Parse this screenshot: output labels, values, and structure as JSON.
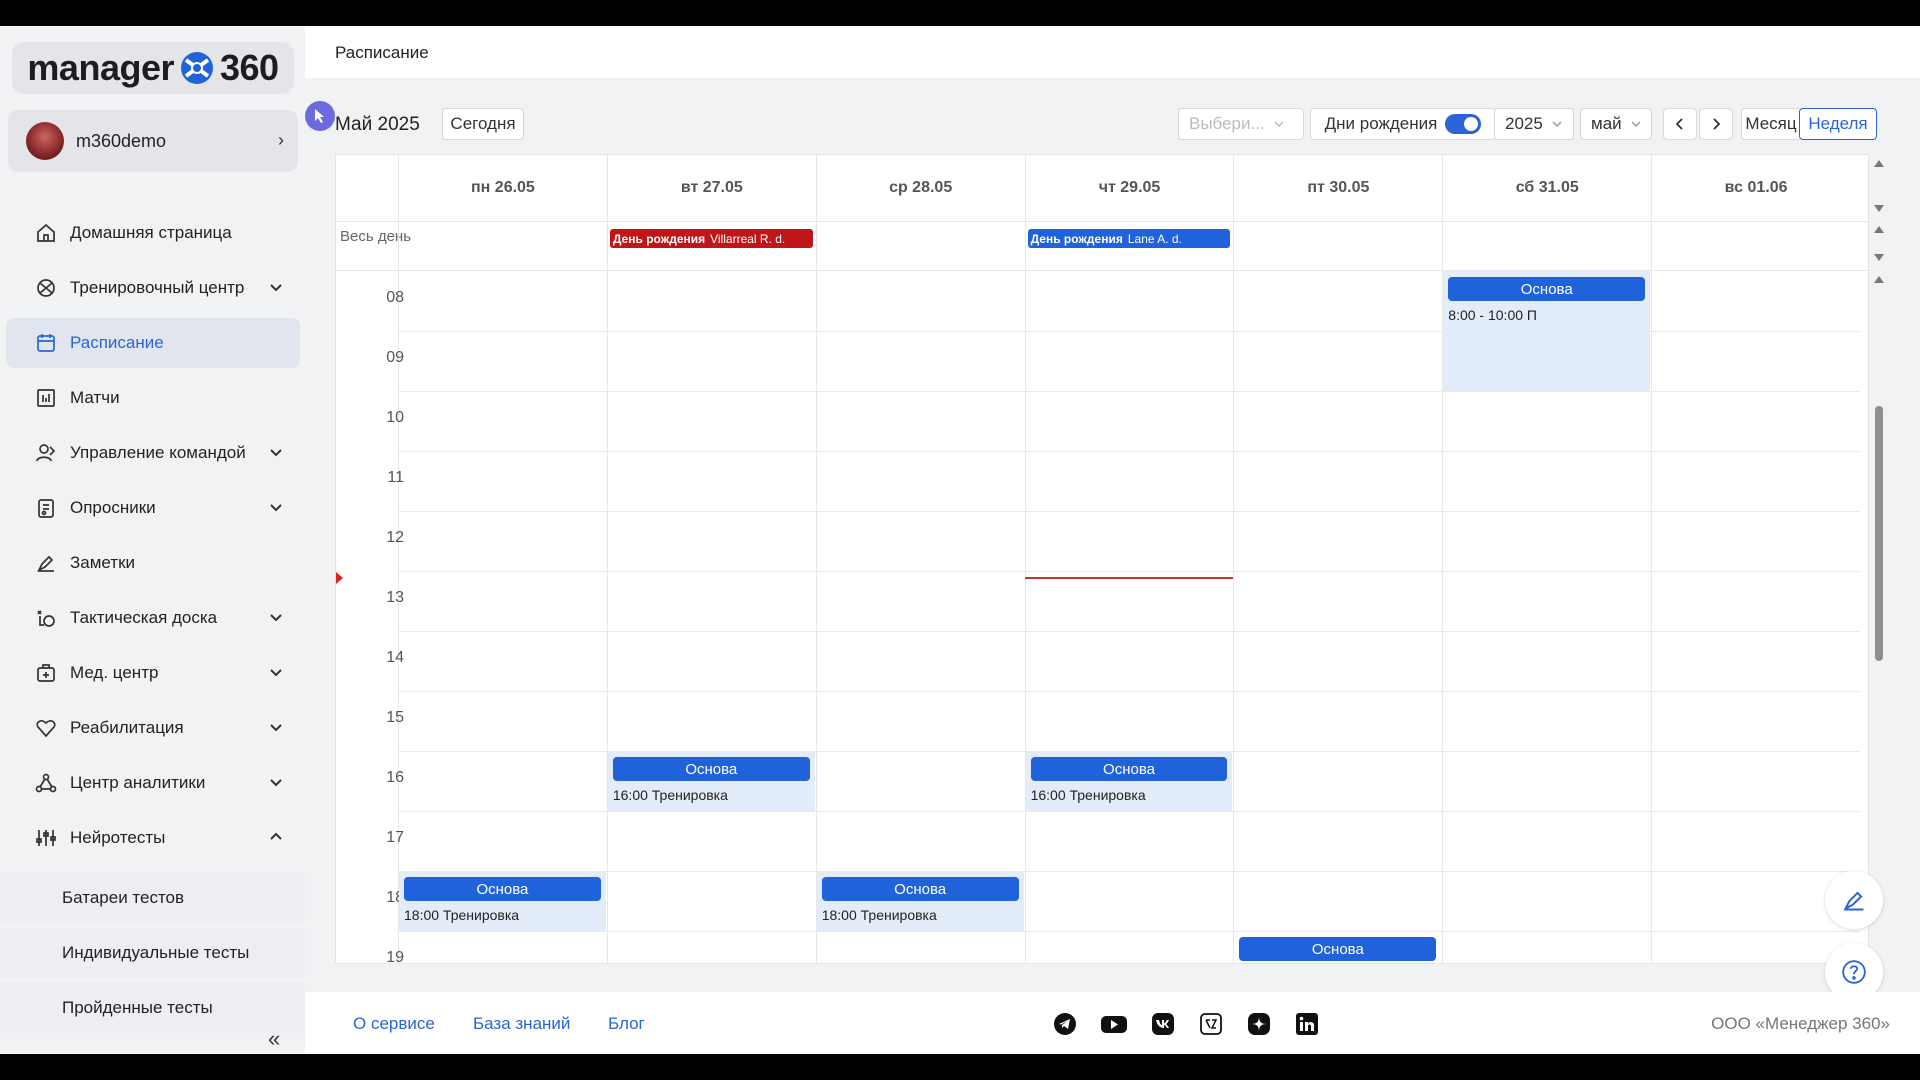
{
  "logo": {
    "text_left": "manager",
    "text_right": "360"
  },
  "user": {
    "name": "m360demo"
  },
  "nav": [
    {
      "label": "Домашняя страница"
    },
    {
      "label": "Тренировочный центр"
    },
    {
      "label": "Расписание"
    },
    {
      "label": "Матчи"
    },
    {
      "label": "Управление командой"
    },
    {
      "label": "Опросники"
    },
    {
      "label": "Заметки"
    },
    {
      "label": "Тактическая доска"
    },
    {
      "label": "Мед. центр"
    },
    {
      "label": "Реабилитация"
    },
    {
      "label": "Центр аналитики"
    },
    {
      "label": "Нейротесты"
    }
  ],
  "subnav": [
    {
      "label": "Батареи тестов"
    },
    {
      "label": "Индивидуальные тесты"
    },
    {
      "label": "Пройденные тесты"
    }
  ],
  "page_title": "Расписание",
  "toolbar": {
    "month_title": "Май 2025",
    "today": "Сегодня",
    "select_placeholder": "Выбери...",
    "birthdays": "Дни рождения",
    "birthdays_on": true,
    "year": "2025",
    "month": "май",
    "view_month": "Месяц",
    "view_week": "Неделя"
  },
  "calendar": {
    "days": [
      "пн 26.05",
      "вт 27.05",
      "ср 28.05",
      "чт 29.05",
      "пт 30.05",
      "сб 31.05",
      "вс 01.06"
    ],
    "allday_label": "Весь день",
    "hours": [
      "08",
      "09",
      "10",
      "11",
      "12",
      "13",
      "14",
      "15",
      "16",
      "17",
      "18",
      "19"
    ],
    "birthdays": [
      {
        "day": 1,
        "label": "День рождения",
        "name": "Villarreal R. d.",
        "color": "#c0161a"
      },
      {
        "day": 3,
        "label": "День рождения",
        "name": "Lane A. d.",
        "color": "#1f62d9"
      }
    ],
    "events": [
      {
        "day": 5,
        "start": 8,
        "end": 10,
        "title": "Основа",
        "text": "8:00 - 10:00 П"
      },
      {
        "day": 1,
        "start": 16,
        "end": 17,
        "title": "Основа",
        "text": "16:00 Тренировка"
      },
      {
        "day": 3,
        "start": 16,
        "end": 17,
        "title": "Основа",
        "text": "16:00 Тренировка"
      },
      {
        "day": 0,
        "start": 18,
        "end": 19,
        "title": "Основа",
        "text": "18:00 Тренировка"
      },
      {
        "day": 2,
        "start": 18,
        "end": 19,
        "title": "Основа",
        "text": "18:00 Тренировка"
      },
      {
        "day": 4,
        "start": 19,
        "end": 20,
        "title": "Основа",
        "text": ""
      }
    ],
    "now_hour": 13,
    "now_day": 3,
    "event_color": "#1f62d9"
  },
  "footer": {
    "links": [
      "О сервисе",
      "База знаний",
      "Блог"
    ],
    "social": [
      "telegram-icon",
      "youtube-icon",
      "vk-icon",
      "yandex-zen-icon",
      "dzen-star-icon",
      "linkedin-icon"
    ],
    "copyright": "ООО «Менеджер 360»"
  }
}
